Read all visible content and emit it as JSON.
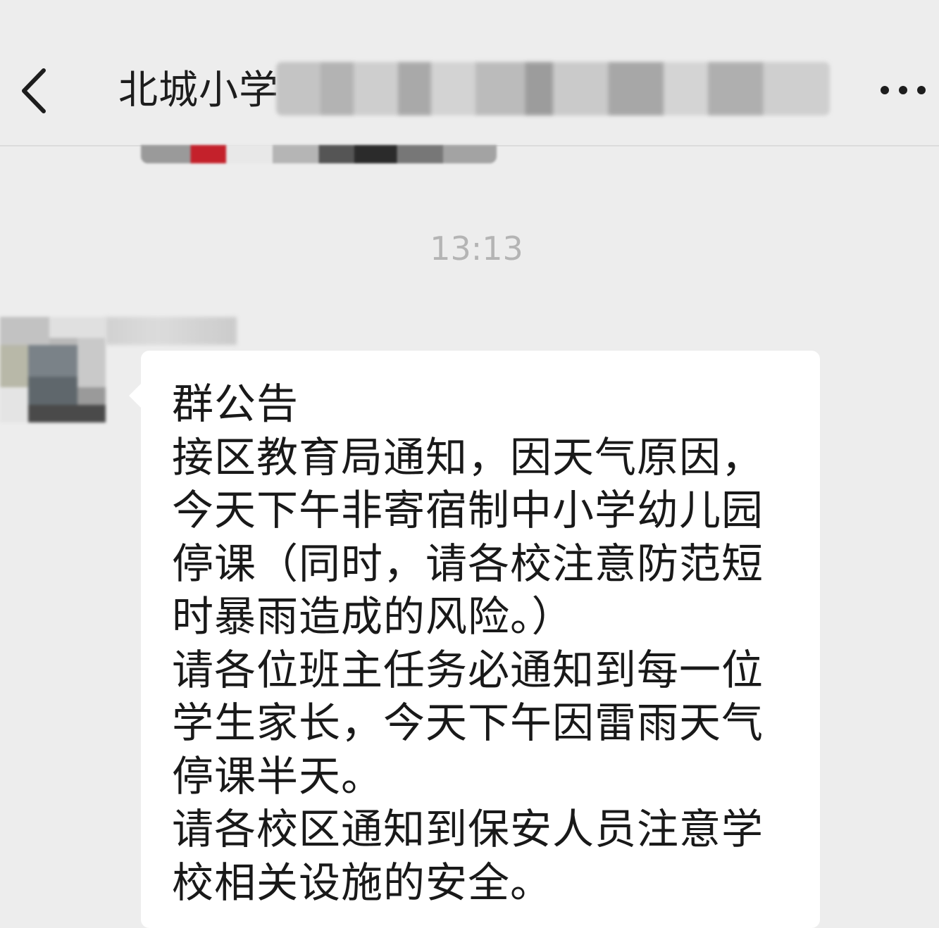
{
  "header": {
    "title": "北城小学",
    "back_icon": "chevron-left-icon",
    "more_icon": "more-horizontal-icon"
  },
  "chat": {
    "timestamp": "13:13",
    "message": {
      "lines": [
        "群公告",
        "接区教育局通知，因天气原因，",
        "今天下午非寄宿制中小学幼儿园",
        "停课（同时，请各校注意防范短",
        "时暴雨造成的风险。）",
        "请各位班主任务必通知到每一位",
        "学生家长，今天下午因雷雨天气",
        "停课半天。",
        "请各校区通知到保安人员注意学",
        "校相关设施的安全。"
      ]
    }
  },
  "colors": {
    "background": "#ededed",
    "bubble": "#ffffff",
    "text": "#191919",
    "timestamp": "#b4b4b4"
  }
}
